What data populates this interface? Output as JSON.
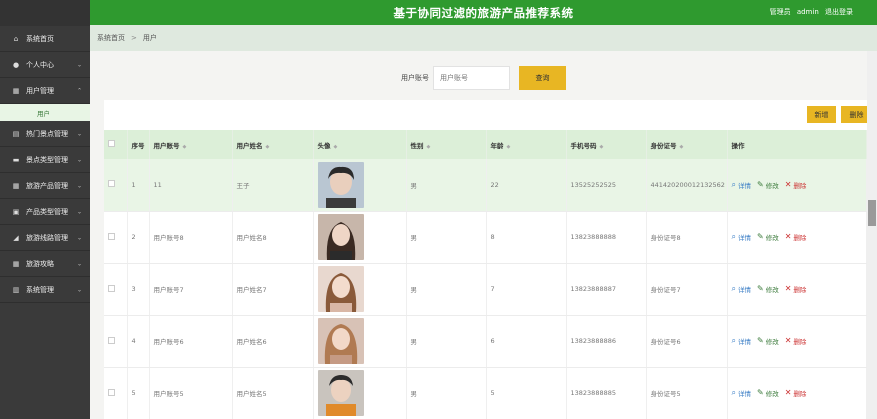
{
  "header": {
    "title": "基于协同过滤的旅游产品推荐系统",
    "user_role": "管理员",
    "username": "admin",
    "logout": "退出登录"
  },
  "sidebar": {
    "items": [
      {
        "label": "系统首页",
        "icon": "home-icon"
      },
      {
        "label": "个人中心",
        "icon": "person-icon"
      },
      {
        "label": "用户管理",
        "icon": "grid-icon",
        "expanded": true
      },
      {
        "label": "热门景点管理",
        "icon": "book-icon"
      },
      {
        "label": "景点类型管理",
        "icon": "card-icon"
      },
      {
        "label": "旅游产品管理",
        "icon": "grid-icon"
      },
      {
        "label": "产品类型管理",
        "icon": "doc-icon"
      },
      {
        "label": "旅游线路管理",
        "icon": "chart-icon"
      },
      {
        "label": "旅游攻略",
        "icon": "grid-icon"
      },
      {
        "label": "系统管理",
        "icon": "bar-chart-icon"
      }
    ],
    "sub_item": "用户"
  },
  "breadcrumb": {
    "home": "系统首页",
    "sep": ">",
    "current": "用户"
  },
  "search": {
    "label": "用户账号",
    "placeholder": "用户账号",
    "button": "查询"
  },
  "toolbar": {
    "add": "新增",
    "delete": "删除"
  },
  "table": {
    "headers": {
      "index": "序号",
      "account": "用户账号",
      "name": "用户姓名",
      "avatar": "头像",
      "gender": "性别",
      "age": "年龄",
      "phone": "手机号码",
      "id_card": "身份证号",
      "ops": "操作"
    },
    "actions": {
      "detail": "详情",
      "edit": "修改",
      "delete": "删除"
    },
    "rows": [
      {
        "index": "1",
        "account": "11",
        "name": "王子",
        "gender": "男",
        "age": "22",
        "phone": "13525252525",
        "id_card": "441420200012132562"
      },
      {
        "index": "2",
        "account": "用户账号8",
        "name": "用户姓名8",
        "gender": "男",
        "age": "8",
        "phone": "13823888888",
        "id_card": "身份证号8"
      },
      {
        "index": "3",
        "account": "用户账号7",
        "name": "用户姓名7",
        "gender": "男",
        "age": "7",
        "phone": "13823888887",
        "id_card": "身份证号7"
      },
      {
        "index": "4",
        "account": "用户账号6",
        "name": "用户姓名6",
        "gender": "男",
        "age": "6",
        "phone": "13823888886",
        "id_card": "身份证号6"
      },
      {
        "index": "5",
        "account": "用户账号5",
        "name": "用户姓名5",
        "gender": "男",
        "age": "5",
        "phone": "13823888885",
        "id_card": "身份证号5"
      }
    ]
  }
}
